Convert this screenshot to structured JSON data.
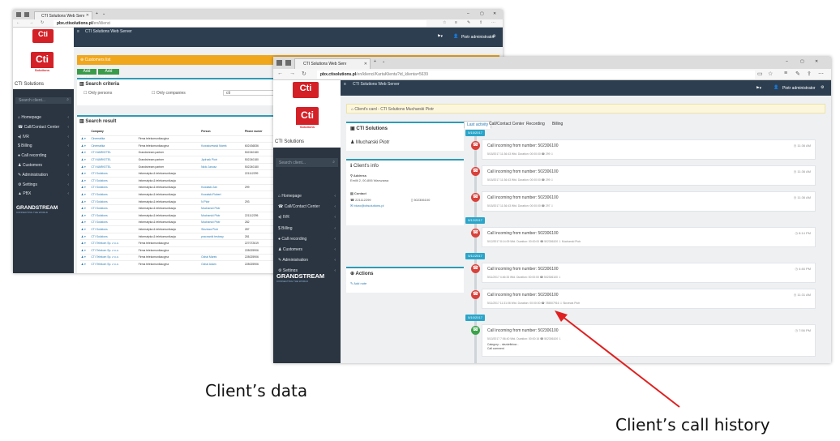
{
  "colors": {
    "accent": "#2e9bb5",
    "sidebar": "#2b3541",
    "appbar": "#2c3e50",
    "arrow": "#e02020",
    "warning": "#f0a71b",
    "missed_call": "#d9413b",
    "answered_call": "#3aa34a"
  },
  "captions": {
    "client_data": "Client’s data",
    "call_history": "Client’s call history"
  },
  "window1": {
    "tab_title": "CTI Solutions Web Serv",
    "url_host": "pbx.ctisolutions.pl",
    "url_path": "/en/klienci",
    "app_title": "CTI Solutions Web Server",
    "user": "Piotr administrator",
    "brand": "CTI Solutions",
    "logo_text": "Cti",
    "logo_sub": "Solutions",
    "search_placeholder": "Search client...",
    "menu": [
      {
        "icon": "home-icon",
        "label": "Homepage"
      },
      {
        "icon": "phone-icon",
        "label": "Call/Contact Center"
      },
      {
        "icon": "volume-icon",
        "label": "IVR"
      },
      {
        "icon": "dollar-icon",
        "label": "Billing"
      },
      {
        "icon": "mic-icon",
        "label": "Call recording"
      },
      {
        "icon": "users-icon",
        "label": "Customers"
      },
      {
        "icon": "edit-icon",
        "label": "Administration"
      },
      {
        "icon": "gears-icon",
        "label": "Settings"
      },
      {
        "icon": "sitemap-icon",
        "label": "PBX"
      }
    ],
    "gs_logo": "GRANDSTREAM",
    "gs_sub": "CONNECTING THE WORLD",
    "warning_label": "Customers list",
    "add_person": "Add person",
    "add_company": "Add company",
    "search_criteria": "Search criteria",
    "only_persons": "Only persons",
    "only_companies": "Only companies",
    "search_value": "cti",
    "search_result": "Search result",
    "columns": [
      "Company",
      "",
      "Person",
      "Phone numer"
    ],
    "rows": [
      [
        "Cinematika",
        "Firma telekomunikacyjna",
        "",
        ""
      ],
      [
        "Cinematika",
        "Firma telekomunikacyjna",
        "Kowalczewski Marek",
        "602436836"
      ],
      [
        "CTI MARKETEL",
        "Grandstream partner",
        "",
        "502240180"
      ],
      [
        "CTI MARKETEL",
        "Grandstream partner",
        "Jędrzak Piotr",
        "502240180"
      ],
      [
        "CTI MARKETEL",
        "Grandstream partner",
        "Nicki Janusz",
        "502240180"
      ],
      [
        "CTI Solutions",
        "Informatyka & telekomunikacja",
        "",
        "221112299"
      ],
      [
        "CTI Solutions",
        "Informatyka & telekomunikacja",
        "",
        ""
      ],
      [
        "CTI Solutions",
        "Informatyka & telekomunikacja",
        "Kowalski Jan",
        "299"
      ],
      [
        "CTI Solutions",
        "Informatyka & telekomunikacja",
        "Kowalski Robert",
        ""
      ],
      [
        "CTI Solutions",
        "Informatyka & telekomunikacja",
        "N Piotr",
        "293"
      ],
      [
        "CTI Solutions",
        "Informatyka & telekomunikacja",
        "Mucharski Piotr",
        ""
      ],
      [
        "CTI Solutions",
        "Informatyka & telekomunikacja",
        "Mucharski Piotr",
        "221112295"
      ],
      [
        "CTI Solutions",
        "Informatyka & telekomunikacja",
        "Mucharski Piotr",
        "282"
      ],
      [
        "CTI Solutions",
        "Informatyka & telekomunikacja",
        "Skrzewa Piotr",
        "287"
      ],
      [
        "CTI Solutions",
        "Informatyka & telekomunikacja",
        "pracownik testowy",
        "281"
      ],
      [
        "CTI Telekom Sp. z o.o.",
        "Firma telekomunikacyjna",
        "",
        "227072619"
      ],
      [
        "CTI Telekom Sp. z o.o.",
        "Firma telekomunikacyjna",
        "",
        "228025906"
      ],
      [
        "CTI Telekom Sp. z o.o.",
        "Firma telekomunikacyjna",
        "Ochal Marek",
        "228025906"
      ],
      [
        "CTI Telekom Sp. z o.o.",
        "Firma telekomunikacyjna",
        "Ochal Adam",
        "228025906"
      ]
    ]
  },
  "window2": {
    "tab_title": "CTI Solutions Web Serv",
    "url_host": "pbx.ctisolutions.pl",
    "url_path": "/en/klienci/KartaKlienta?id_klienta=5639",
    "app_title": "CTI Solutions Web Server",
    "user": "Piotr administrator",
    "brand": "CTI Solutions",
    "logo_text": "Cti",
    "logo_sub": "Solutions",
    "search_placeholder": "Search client...",
    "menu": [
      {
        "icon": "home-icon",
        "label": "Homepage"
      },
      {
        "icon": "phone-icon",
        "label": "Call/Contact Center"
      },
      {
        "icon": "volume-icon",
        "label": "IVR"
      },
      {
        "icon": "dollar-icon",
        "label": "Billing"
      },
      {
        "icon": "mic-icon",
        "label": "Call recording"
      },
      {
        "icon": "users-icon",
        "label": "Customers"
      },
      {
        "icon": "edit-icon",
        "label": "Administration"
      },
      {
        "icon": "gears-icon",
        "label": "Settings"
      },
      {
        "icon": "sitemap-icon",
        "label": "PBX"
      }
    ],
    "gs_logo": "GRANDSTREAM",
    "gs_sub": "CONNECTING THE WORLD",
    "breadcrumb": "Client's card - CTI Solutions Mucharski Piotr",
    "company": "CTI Solutions",
    "person": "Mucharski Piotr",
    "info_title": "Client's info",
    "address_label": "Address",
    "address_value": "Emilii 2, 00-806 Warszawa",
    "contact_label": "Contact",
    "phone1": "221112299",
    "phone2": "502306100",
    "email": "biuro@ctisolutions.pl",
    "actions_title": "Actions",
    "add_note": "Add note",
    "tabs": [
      "Last activity",
      "Call/Contact Center",
      "Recording",
      "Billing"
    ],
    "timeline": [
      {
        "date": "5/15/2017"
      },
      {
        "title": "Call incoming from number: 502306100",
        "time": "11:36 AM",
        "detail": "5/15/2017 11:36:43  Wtd. Duration: 00:00:00   ☎ 299   ⇩",
        "type": "missed"
      },
      {
        "title": "Call incoming from number: 502306100",
        "time": "11:36 AM",
        "detail": "5/15/2017 11:36:43  Wtd. Duration: 00:00:00   ☎ 299   ⇩",
        "type": "missed"
      },
      {
        "title": "Call incoming from number: 502306100",
        "time": "11:36 AM",
        "detail": "5/15/2017 11:36:43  Wtd. Duration: 00:00:00   ☎ 297   ⇩",
        "type": "missed"
      },
      {
        "date": "5/12/2017"
      },
      {
        "title": "Call incoming from number: 502306100",
        "time": "8:14 PM",
        "detail": "5/12/2017 8:14:09  Wtd. Duration: 00:00:00   ☎ 502306100   ⇩ Mucharski Piotr",
        "type": "missed"
      },
      {
        "date": "5/11/2017"
      },
      {
        "title": "Call incoming from number: 502306100",
        "time": "4:46 PM",
        "detail": "5/11/2017 4:46:33  Wtd. Duration: 00:00:00   ☎ 502306100   ⇩",
        "type": "missed"
      },
      {
        "title": "Call incoming from number: 502306100",
        "time": "11:31 AM",
        "detail": "5/11/2017 11:31:06  Wtd. Duration: 00:00:00   ☎ 785507916   ⇩ Skrzewa Piotr",
        "type": "missed"
      },
      {
        "date": "5/10/2017"
      },
      {
        "title": "Call incoming from number: 502306100",
        "time": "7:56 PM",
        "detail": "5/10/2017 7:56:40  Wtd. Duration: 00:00:16   ☎ 502306100   ⇩",
        "extra1": "Category: - niezdefiniow -",
        "extra2": "Call comment",
        "type": "answered"
      }
    ]
  }
}
